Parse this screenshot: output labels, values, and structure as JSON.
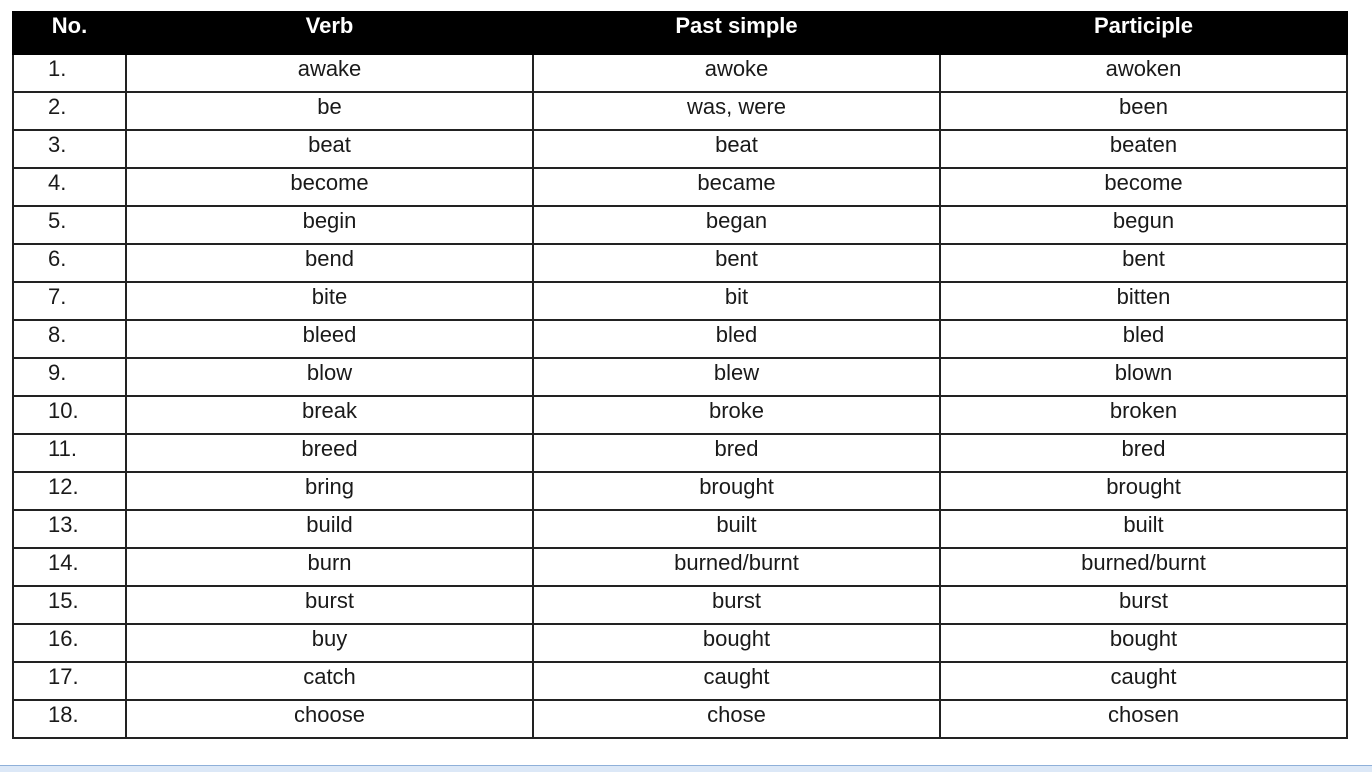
{
  "table": {
    "headers": [
      "No.",
      "Verb",
      "Past simple",
      "Participle"
    ],
    "rows": [
      {
        "no": "1.",
        "verb": "awake",
        "past": "awoke",
        "participle": "awoken"
      },
      {
        "no": "2.",
        "verb": "be",
        "past": "was, were",
        "participle": "been"
      },
      {
        "no": "3.",
        "verb": "beat",
        "past": "beat",
        "participle": "beaten"
      },
      {
        "no": "4.",
        "verb": "become",
        "past": "became",
        "participle": "become"
      },
      {
        "no": "5.",
        "verb": "begin",
        "past": "began",
        "participle": "begun"
      },
      {
        "no": "6.",
        "verb": "bend",
        "past": "bent",
        "participle": "bent"
      },
      {
        "no": "7.",
        "verb": "bite",
        "past": "bit",
        "participle": "bitten"
      },
      {
        "no": "8.",
        "verb": "bleed",
        "past": "bled",
        "participle": "bled"
      },
      {
        "no": "9.",
        "verb": "blow",
        "past": "blew",
        "participle": "blown"
      },
      {
        "no": "10.",
        "verb": "break",
        "past": "broke",
        "participle": "broken"
      },
      {
        "no": "11.",
        "verb": "breed",
        "past": "bred",
        "participle": "bred"
      },
      {
        "no": "12.",
        "verb": "bring",
        "past": "brought",
        "participle": "brought"
      },
      {
        "no": "13.",
        "verb": "build",
        "past": "built",
        "participle": "built"
      },
      {
        "no": "14.",
        "verb": "burn",
        "past": "burned/burnt",
        "participle": "burned/burnt"
      },
      {
        "no": "15.",
        "verb": "burst",
        "past": "burst",
        "participle": "burst"
      },
      {
        "no": "16.",
        "verb": "buy",
        "past": "bought",
        "participle": "bought"
      },
      {
        "no": "17.",
        "verb": "catch",
        "past": "caught",
        "participle": "caught"
      },
      {
        "no": "18.",
        "verb": "choose",
        "past": "chose",
        "participle": "chosen"
      }
    ]
  },
  "colors": {
    "header_bg": "#000000",
    "header_text": "#ffffff",
    "border": "#222222",
    "bottom_strip": "#dce8f7"
  }
}
